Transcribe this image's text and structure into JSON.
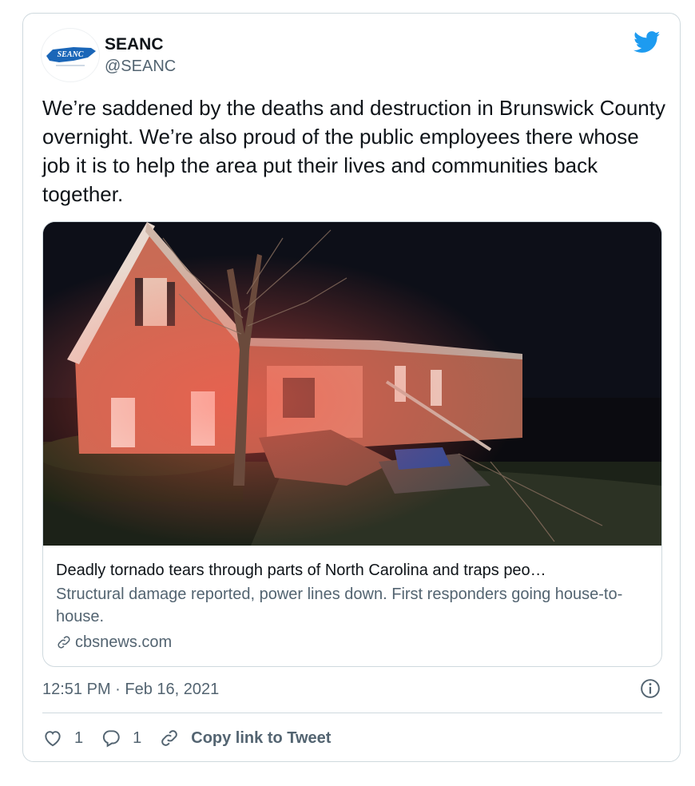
{
  "author": {
    "name": "SEANC",
    "handle": "@SEANC",
    "avatar_text": "SEANC"
  },
  "tweet": {
    "text": "We’re saddened by the deaths and destruction in Brunswick County overnight. We’re also proud of the public employees there whose job it is to help the area put their lives and communities back together."
  },
  "link_card": {
    "title": "Deadly tornado tears through parts of North Carolina and traps peo…",
    "description": "Structural damage reported, power lines down. First responders going house-to-house.",
    "domain": "cbsnews.com"
  },
  "meta": {
    "timestamp": "12:51 PM · Feb 16, 2021"
  },
  "actions": {
    "like_count": "1",
    "reply_count": "1",
    "copy_link_label": "Copy link to Tweet"
  },
  "colors": {
    "brand_blue": "#1d9bf0",
    "secondary_text": "#536471",
    "border": "#cfd9de"
  },
  "icons": [
    "twitter-bird-icon",
    "info-icon",
    "heart-icon",
    "reply-icon",
    "link-icon"
  ]
}
